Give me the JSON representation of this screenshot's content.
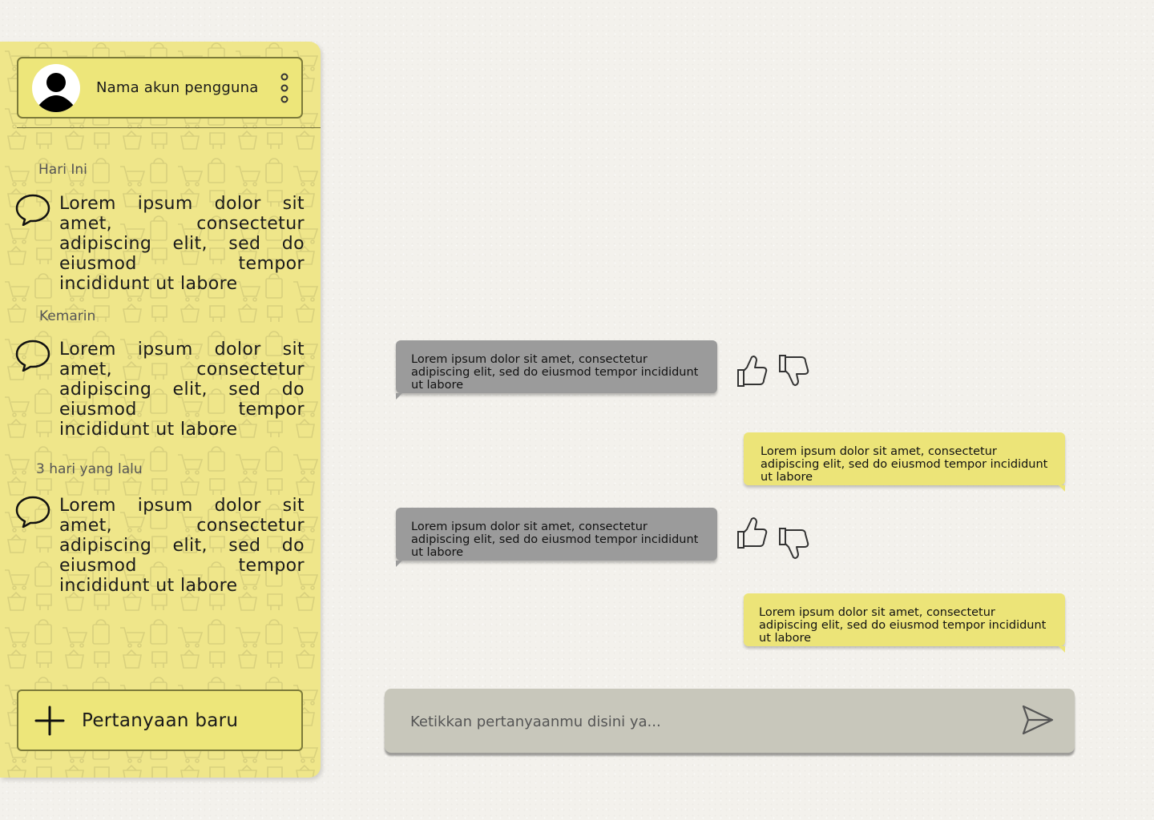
{
  "sidebar": {
    "account_name": "Nama akun pengguna",
    "groups": [
      {
        "label": "Hari Ini",
        "item": "Lorem ipsum dolor sit amet, consectetur adipiscing elit, sed do eiusmod tempor incididunt ut labore"
      },
      {
        "label": "Kemarin",
        "item": "Lorem ipsum dolor sit amet, consectetur adipiscing elit, sed do eiusmod tempor incididunt ut labore"
      },
      {
        "label": "3 hari yang lalu",
        "item": "Lorem ipsum dolor sit amet, consectetur adipiscing elit, sed do eiusmod tempor incididunt ut labore"
      }
    ],
    "new_question_label": "Pertanyaan baru"
  },
  "chat": {
    "messages": [
      {
        "role": "bot",
        "text": "Lorem ipsum dolor sit amet, consectetur adipiscing elit, sed do eiusmod tempor incididunt ut labore"
      },
      {
        "role": "user",
        "text": "Lorem ipsum dolor sit amet, consectetur adipiscing elit, sed do eiusmod tempor incididunt ut labore"
      },
      {
        "role": "bot",
        "text": "Lorem ipsum dolor sit amet, consectetur adipiscing elit, sed do eiusmod tempor incididunt ut labore"
      },
      {
        "role": "user",
        "text": "Lorem ipsum dolor sit amet, consectetur adipiscing elit, sed do eiusmod tempor incididunt ut labore"
      }
    ],
    "input_placeholder": "Ketikkan pertanyaanmu disini ya..."
  },
  "colors": {
    "sidebar_bg": "#efe68a",
    "accent_yellow": "#ece478",
    "bot_bubble": "#9b9b9b",
    "input_bg": "#c8c7bb"
  }
}
